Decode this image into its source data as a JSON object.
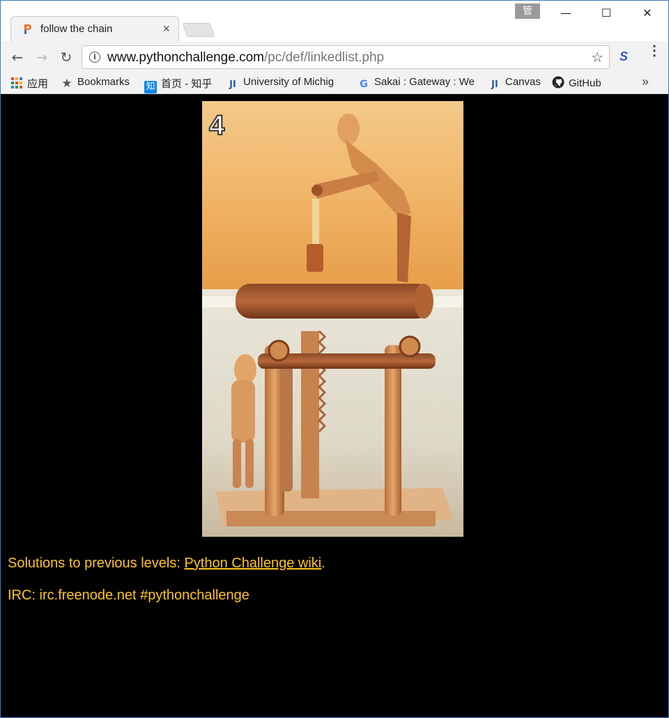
{
  "browser": {
    "tab_title": "follow the chain",
    "tab_close": "×",
    "ime_indicator": "管",
    "window_controls": {
      "minimize": "—",
      "maximize": "☐",
      "close": "✕"
    },
    "nav": {
      "back": "←",
      "forward": "→",
      "reload": "↻"
    },
    "url_host": "www.pythonchallenge.com",
    "url_path": "/pc/def/linkedlist.php",
    "info_glyph": "i",
    "star_glyph": "☆",
    "extension_glyph": "S",
    "menu_glyph": "⋮",
    "bookmarks": [
      {
        "label": "应用",
        "icon": "apps-grid-icon"
      },
      {
        "label": "Bookmarks",
        "icon": "star-icon",
        "glyph": "★"
      },
      {
        "label": "首页 - 知乎",
        "icon": "zhihu-icon",
        "glyph": "知"
      },
      {
        "label": "University of Michig",
        "icon": "ji-icon",
        "glyph": "JI"
      },
      {
        "label": "Sakai : Gateway : We",
        "icon": "google-icon",
        "glyph": "G"
      },
      {
        "label": "Canvas",
        "icon": "ji-icon",
        "glyph": "JI"
      },
      {
        "label": "GitHub",
        "icon": "github-icon"
      }
    ],
    "bookmarks_overflow": "»"
  },
  "page": {
    "image": {
      "level_number": "4",
      "description_icon": "puzzle-image"
    },
    "solutions_prefix": "Solutions to previous levels: ",
    "solutions_link": "Python Challenge wiki",
    "solutions_suffix": ".",
    "irc_text": "IRC: irc.freenode.net #pythonchallenge",
    "text_color": "#ffc61a",
    "background_color": "#000000"
  }
}
